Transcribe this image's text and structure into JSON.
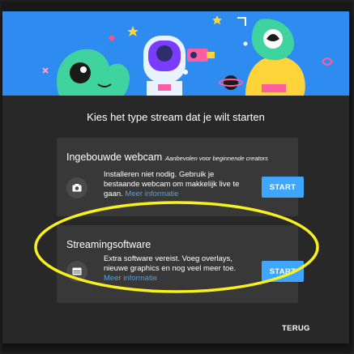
{
  "dialog": {
    "title": "Kies het type stream dat je wilt starten",
    "back_label": "TERUG"
  },
  "options": [
    {
      "title": "Ingebouwde webcam",
      "subtitle": "Aanbevolen voor beginnende creators",
      "description": "Installeren niet nodig. Gebruik je bestaande webcam om makkelijk live te gaan.",
      "link": "Meer informatie",
      "button": "START",
      "icon": "camera-icon"
    },
    {
      "title": "Streamingsoftware",
      "subtitle": "",
      "description": "Extra software vereist. Voeg overlays, nieuwe graphics en nog veel meer toe.",
      "link": "Meer informatie",
      "button": "START",
      "icon": "software-window-icon"
    }
  ],
  "colors": {
    "accent": "#3ea6ff",
    "banner": "#2e8cf0",
    "highlight": "#f7f11e",
    "card": "#383838",
    "dialog": "#282828"
  }
}
